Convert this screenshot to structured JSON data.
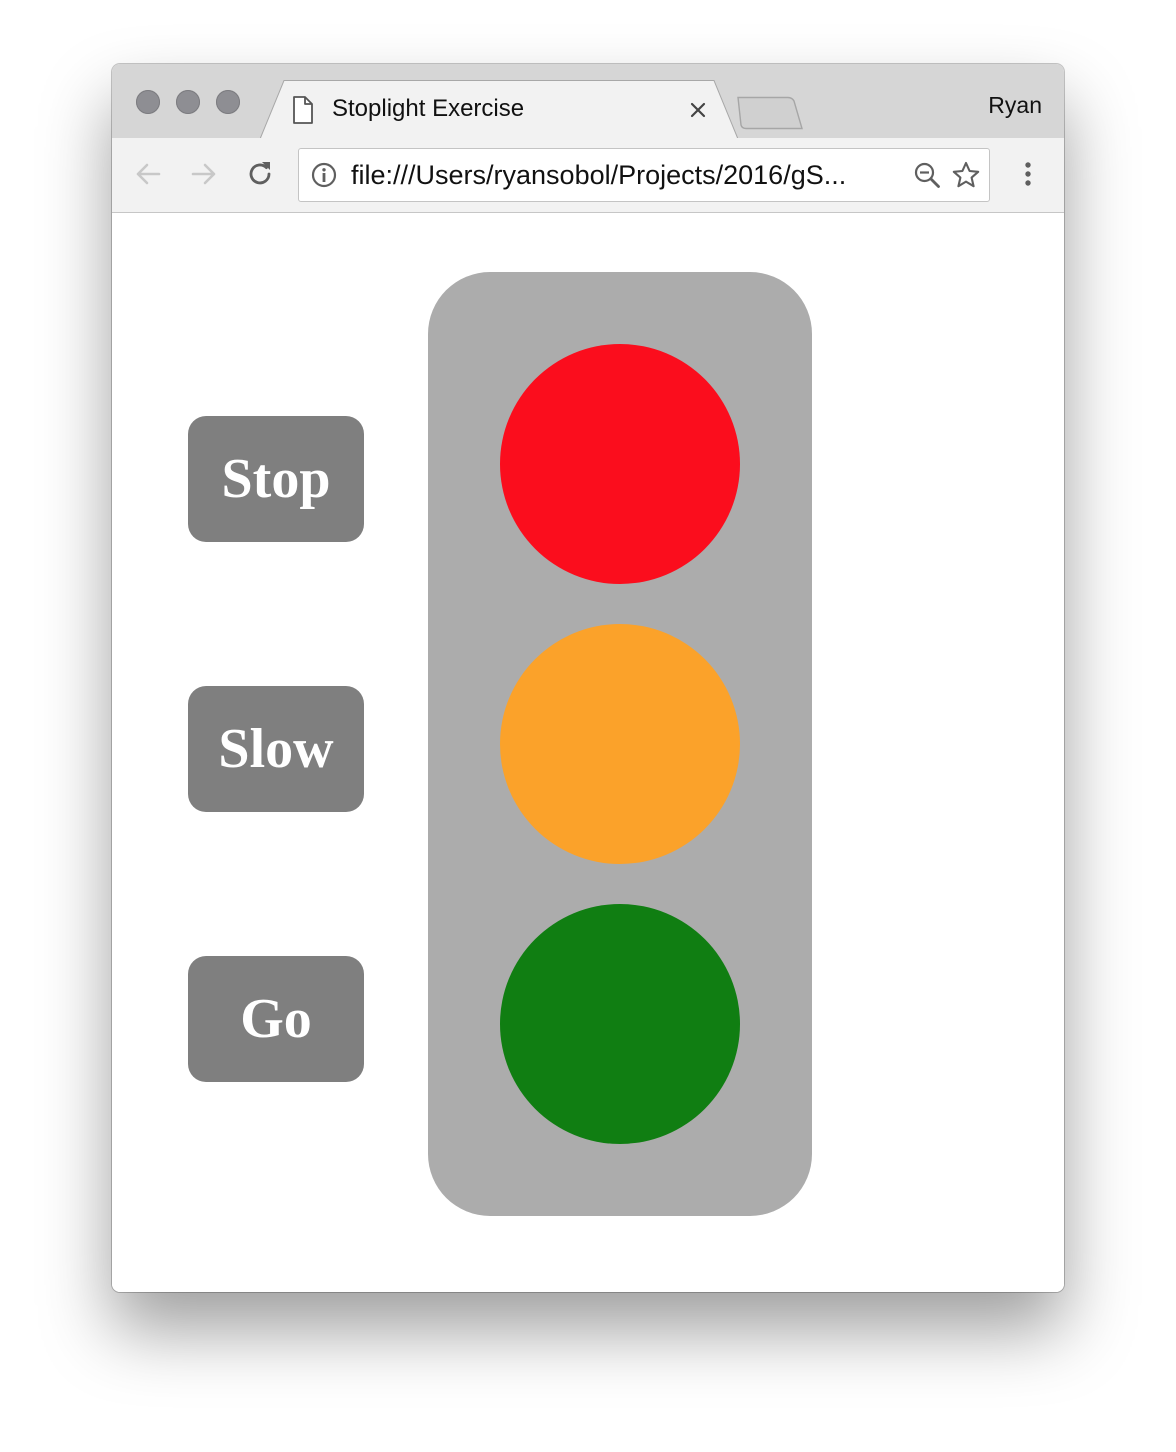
{
  "window": {
    "profile_name": "Ryan"
  },
  "tab": {
    "title": "Stoplight Exercise",
    "icon": "page-icon"
  },
  "toolbar": {
    "back_icon": "arrow-left-icon",
    "forward_icon": "arrow-right-icon",
    "reload_icon": "reload-icon",
    "url": "file:///Users/ryansobol/Projects/2016/gS...",
    "menu_icon": "kebab-menu-icon"
  },
  "controls": [
    {
      "label": "Stop"
    },
    {
      "label": "Slow"
    },
    {
      "label": "Go"
    }
  ],
  "stoplight": {
    "housing_color": "#acacac",
    "bulbs": [
      {
        "name": "stop",
        "color": "#fb0d1d"
      },
      {
        "name": "slow",
        "color": "#fba22a"
      },
      {
        "name": "go",
        "color": "#107e12"
      }
    ]
  },
  "colors": {
    "button_bg": "#7f7f7f",
    "button_text": "#ffffff"
  }
}
